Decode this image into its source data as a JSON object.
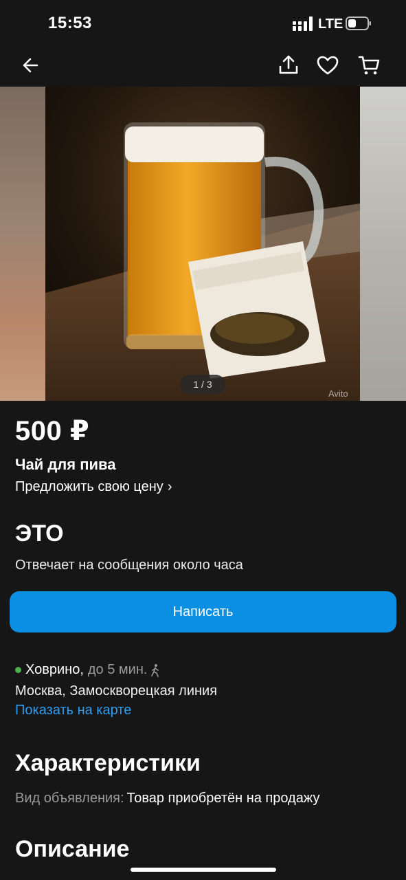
{
  "status": {
    "time": "15:53",
    "network": "LTE"
  },
  "nav": {
    "back_icon": "arrow-left-icon",
    "share_icon": "share-icon",
    "favorite_icon": "heart-icon",
    "cart_icon": "cart-icon"
  },
  "gallery": {
    "counter": "1 / 3",
    "watermark": "Avito"
  },
  "listing": {
    "price": "500 ₽",
    "title": "Чай для пива",
    "offer_label": "Предложить свою цену",
    "offer_chevron": "›"
  },
  "seller": {
    "name": "ЭТО",
    "reply_time": "Отвечает на сообщения около часа",
    "write_button": "Написать"
  },
  "location": {
    "metro": "Ховрино,",
    "travel_time": "до 5 мин.",
    "metro_color": "#4caf50",
    "city_line": "Москва, Замоскворецкая линия",
    "map_link": "Показать на карте"
  },
  "specs": {
    "heading": "Характеристики",
    "rows": [
      {
        "key": "Вид объявления:",
        "value": "Товар приобретён на продажу"
      }
    ]
  },
  "description": {
    "heading": "Описание"
  },
  "colors": {
    "accent": "#0a8fe3",
    "link": "#2e9df0",
    "background": "#161616"
  }
}
